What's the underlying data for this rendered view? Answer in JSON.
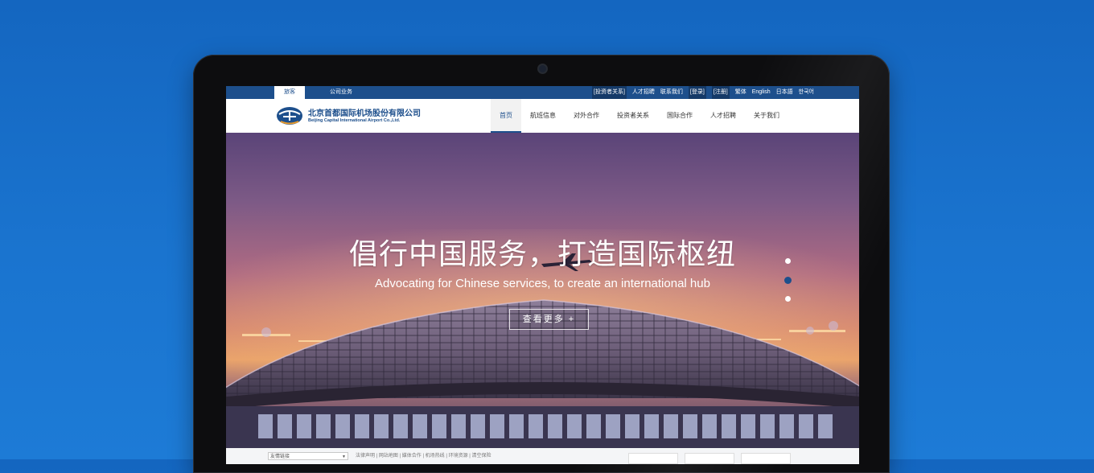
{
  "topbar": {
    "tabs": [
      {
        "label": "旅客",
        "active": true
      },
      {
        "label": "公司业务",
        "active": false
      }
    ],
    "links": [
      {
        "label": "[投资者关系]",
        "boxed": true
      },
      {
        "label": "人才招聘",
        "boxed": false
      },
      {
        "label": "联系我们",
        "boxed": false
      },
      {
        "label": "[登录]",
        "boxed": true
      },
      {
        "label": "[注册]",
        "boxed": true
      },
      {
        "label": "繁体",
        "boxed": false
      },
      {
        "label": "English",
        "boxed": false
      },
      {
        "label": "日本語",
        "boxed": false
      },
      {
        "label": "한국어",
        "boxed": false
      }
    ]
  },
  "header": {
    "logo_cn": "北京首都国际机场股份有限公司",
    "logo_en": "Beijing Capital International Airport Co.,Ltd.",
    "nav": [
      {
        "label": "首页",
        "active": true
      },
      {
        "label": "航班信息",
        "active": false
      },
      {
        "label": "对外合作",
        "active": false
      },
      {
        "label": "投资者关系",
        "active": false
      },
      {
        "label": "国际合作",
        "active": false
      },
      {
        "label": "人才招聘",
        "active": false
      },
      {
        "label": "关于我们",
        "active": false
      }
    ]
  },
  "hero": {
    "title": "倡行中国服务，打造国际枢纽",
    "subtitle": "Advocating for Chinese services, to create an international hub",
    "button": "查看更多 +",
    "slides_count": 3,
    "active_slide": 2
  },
  "footer": {
    "select_value": "友情链接",
    "links": "法律声明 | 网站地图 | 媒体合作 | 机场热线 | 环境资源 | 清空保险"
  },
  "colors": {
    "brand": "#1d4f8c",
    "page_background": "#1a70ca"
  }
}
